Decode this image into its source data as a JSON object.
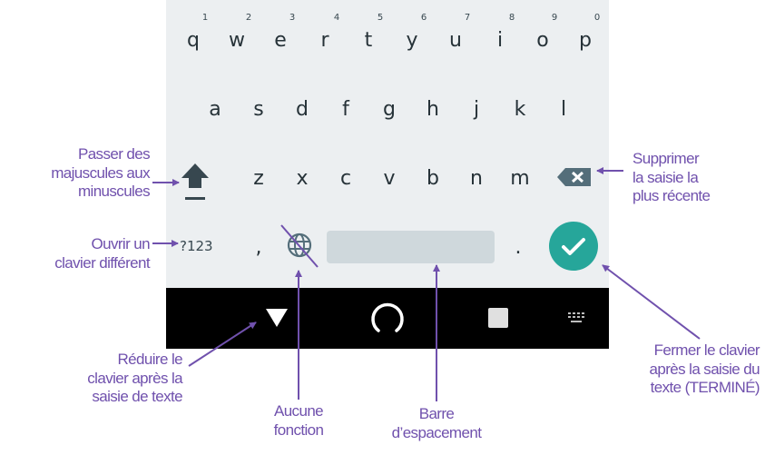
{
  "keyboard": {
    "row1": [
      {
        "key": "q",
        "hint": "1"
      },
      {
        "key": "w",
        "hint": "2"
      },
      {
        "key": "e",
        "hint": "3"
      },
      {
        "key": "r",
        "hint": "4"
      },
      {
        "key": "t",
        "hint": "5"
      },
      {
        "key": "y",
        "hint": "6"
      },
      {
        "key": "u",
        "hint": "7"
      },
      {
        "key": "i",
        "hint": "8"
      },
      {
        "key": "o",
        "hint": "9"
      },
      {
        "key": "p",
        "hint": "0"
      }
    ],
    "row2": [
      "a",
      "s",
      "d",
      "f",
      "g",
      "h",
      "j",
      "k",
      "l"
    ],
    "row3": [
      "z",
      "x",
      "c",
      "v",
      "b",
      "n",
      "m"
    ],
    "symbols_key": "?123",
    "comma_key": ",",
    "period_key": "."
  },
  "icons": {
    "shift": "shift-arrow-icon",
    "delete": "backspace-icon",
    "globe": "globe-icon",
    "done": "checkmark-icon",
    "nav_back": "triangle-down-icon",
    "nav_home": "circle-icon",
    "nav_recents": "square-icon",
    "nav_keyboard": "keyboard-icon"
  },
  "colors": {
    "annotation": "#7051ad",
    "done_button": "#26a69a",
    "keyboard_bg": "#eceff1",
    "navbar_bg": "#000000"
  },
  "annotations": {
    "shift": [
      "Passer des",
      "majuscules aux",
      "minuscules"
    ],
    "other_keyboard": [
      "Ouvrir un",
      "clavier différent"
    ],
    "delete": [
      "Supprimer",
      "la saisie la",
      "plus récente"
    ],
    "collapse": [
      "Réduire le",
      "clavier après la",
      "saisie de texte"
    ],
    "no_function": [
      "Aucune",
      "fonction"
    ],
    "spacebar": [
      "Barre",
      "d’espacement"
    ],
    "done": [
      "Fermer le clavier",
      "après la saisie du",
      "texte (TERMINÉ)"
    ]
  }
}
